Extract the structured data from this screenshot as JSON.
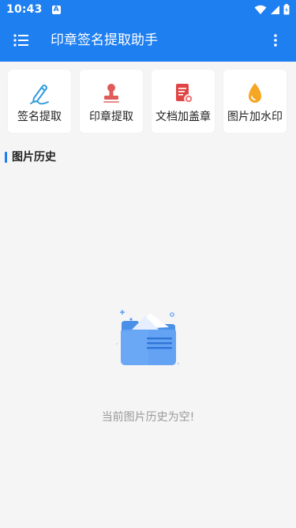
{
  "status_bar": {
    "time": "10:43",
    "notification_icon": "A"
  },
  "app_bar": {
    "title": "印章签名提取助手"
  },
  "tools": [
    {
      "label": "签名提取",
      "icon": "signature-pen-icon",
      "color": "#2f9be0"
    },
    {
      "label": "印章提取",
      "icon": "stamp-icon",
      "color": "#e05a5a"
    },
    {
      "label": "文档加盖章",
      "icon": "document-stamp-icon",
      "color": "#e04545"
    },
    {
      "label": "图片加水印",
      "icon": "watermark-drop-icon",
      "color": "#f5a623"
    }
  ],
  "history": {
    "title": "图片历史",
    "empty_text": "当前图片历史为空!"
  },
  "colors": {
    "primary": "#1e7ff0",
    "background": "#f5f5f5"
  }
}
